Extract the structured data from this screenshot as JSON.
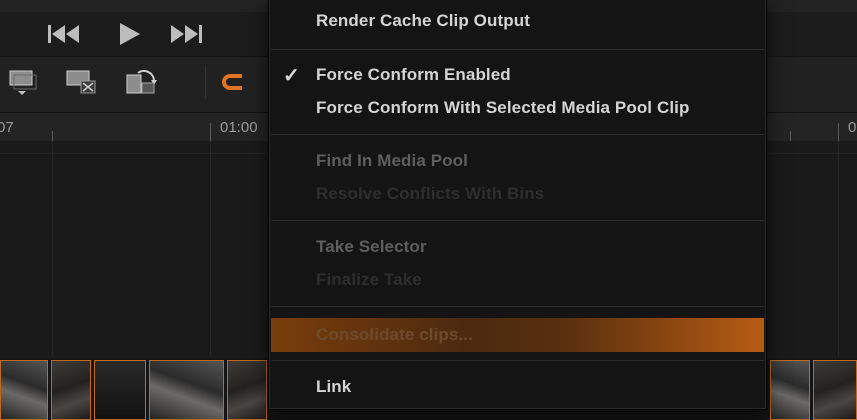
{
  "ruler": {
    "timecodes": [
      "07",
      "01:00",
      "0"
    ]
  },
  "menu": {
    "items": [
      {
        "label": "Render Cache Clip Output",
        "state": "enabled"
      },
      {
        "label": "Force Conform Enabled",
        "state": "enabled",
        "checked": true
      },
      {
        "label": "Force Conform With Selected Media Pool Clip",
        "state": "enabled"
      },
      {
        "label": "Find In Media Pool",
        "state": "disabled"
      },
      {
        "label": "Resolve Conflicts With Bins",
        "state": "disabled"
      },
      {
        "label": "Take Selector",
        "state": "disabled"
      },
      {
        "label": "Finalize Take",
        "state": "disabled"
      },
      {
        "label": "Consolidate clips...",
        "state": "highlighted"
      },
      {
        "label": "Link",
        "state": "enabled"
      }
    ],
    "checkmark": "✓"
  },
  "colors": {
    "accent": "#c16a1c",
    "highlight_start": "#7a3d0c",
    "highlight_end": "#b85c14",
    "menu_bg": "#141414",
    "text_enabled": "#d4d4d4",
    "text_disabled": "#5e5e5e"
  },
  "icons": {
    "transport": [
      "skip-back-icon",
      "play-icon",
      "skip-forward-icon"
    ],
    "tools": [
      "clip-stack-dropdown-icon",
      "clip-delete-icon",
      "clip-replace-icon",
      "snap-magnet-icon"
    ]
  }
}
